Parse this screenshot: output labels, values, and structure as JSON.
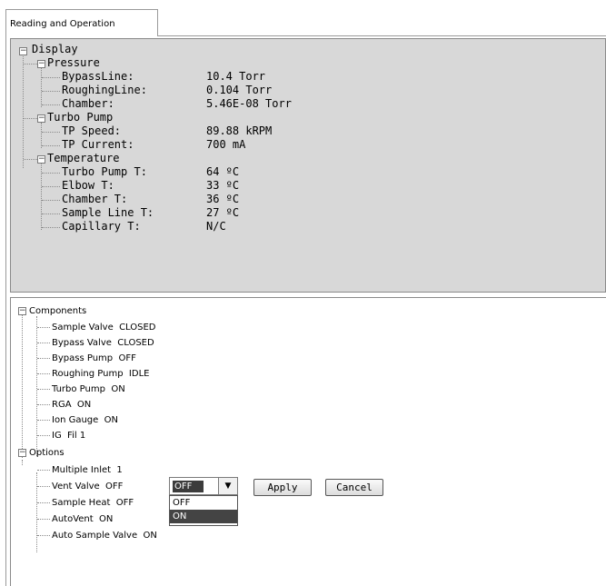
{
  "tab": {
    "label": "Reading and Operation"
  },
  "display": {
    "root": "Display",
    "pressure": {
      "label": "Pressure",
      "items": [
        {
          "label": "BypassLine:",
          "value": "10.4 Torr"
        },
        {
          "label": "RoughingLine:",
          "value": "0.104 Torr"
        },
        {
          "label": "Chamber:",
          "value": "5.46E-08 Torr"
        }
      ]
    },
    "turbo": {
      "label": "Turbo Pump",
      "items": [
        {
          "label": "TP Speed:",
          "value": "89.88 kRPM"
        },
        {
          "label": "TP Current:",
          "value": "700 mA"
        }
      ]
    },
    "temperature": {
      "label": "Temperature",
      "items": [
        {
          "label": "Turbo Pump T:",
          "value": "64 ºC"
        },
        {
          "label": "Elbow T:",
          "value": "33 ºC"
        },
        {
          "label": "Chamber T:",
          "value": "36 ºC"
        },
        {
          "label": "Sample Line T:",
          "value": "27 ºC"
        },
        {
          "label": "Capillary T:",
          "value": "N/C"
        }
      ]
    }
  },
  "components": {
    "label": "Components",
    "items": [
      "Sample Valve  CLOSED",
      "Bypass Valve  CLOSED",
      "Bypass Pump  OFF",
      "Roughing Pump  IDLE",
      "Turbo Pump  ON",
      "RGA  ON",
      "Ion Gauge  ON",
      "IG  Fil 1"
    ]
  },
  "options": {
    "label": "Options",
    "items": [
      "Multiple Inlet  1",
      "Vent Valve  OFF",
      "Sample Heat  OFF",
      "AutoVent  ON",
      "Auto Sample Valve  ON"
    ],
    "combo": {
      "selected": "OFF",
      "options": [
        "OFF",
        "ON"
      ]
    },
    "apply_label": "Apply",
    "cancel_label": "Cancel"
  },
  "icons": {
    "collapse": "minus-box-icon",
    "dropdown": "chevron-down-icon"
  }
}
